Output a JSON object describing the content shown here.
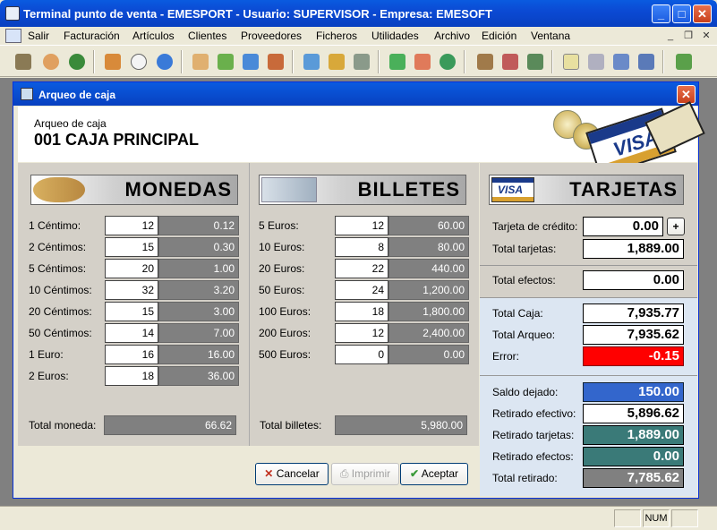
{
  "window": {
    "title": "Terminal punto de venta - EMESPORT - Usuario: SUPERVISOR - Empresa: EMESOFT"
  },
  "menu": [
    "Salir",
    "Facturación",
    "Artículos",
    "Clientes",
    "Proveedores",
    "Ficheros",
    "Utilidades",
    "Archivo",
    "Edición",
    "Ventana"
  ],
  "dialog": {
    "title": "Arqueo de caja",
    "header_label": "Arqueo de caja",
    "header_value": "001 CAJA PRINCIPAL"
  },
  "monedas": {
    "title": "MONEDAS",
    "rows": [
      {
        "label": "1 Céntimo:",
        "qty": "12",
        "amount": "0.12"
      },
      {
        "label": "2 Céntimos:",
        "qty": "15",
        "amount": "0.30"
      },
      {
        "label": "5 Céntimos:",
        "qty": "20",
        "amount": "1.00"
      },
      {
        "label": "10 Céntimos:",
        "qty": "32",
        "amount": "3.20"
      },
      {
        "label": "20 Céntimos:",
        "qty": "15",
        "amount": "3.00"
      },
      {
        "label": "50 Céntimos:",
        "qty": "14",
        "amount": "7.00"
      },
      {
        "label": "1 Euro:",
        "qty": "16",
        "amount": "16.00"
      },
      {
        "label": "2 Euros:",
        "qty": "18",
        "amount": "36.00"
      }
    ],
    "total_label": "Total moneda:",
    "total": "66.62"
  },
  "billetes": {
    "title": "BILLETES",
    "rows": [
      {
        "label": "5 Euros:",
        "qty": "12",
        "amount": "60.00"
      },
      {
        "label": "10 Euros:",
        "qty": "8",
        "amount": "80.00"
      },
      {
        "label": "20 Euros:",
        "qty": "22",
        "amount": "440.00"
      },
      {
        "label": "50 Euros:",
        "qty": "24",
        "amount": "1,200.00"
      },
      {
        "label": "100 Euros:",
        "qty": "18",
        "amount": "1,800.00"
      },
      {
        "label": "200 Euros:",
        "qty": "12",
        "amount": "2,400.00"
      },
      {
        "label": "500 Euros:",
        "qty": "0",
        "amount": "0.00"
      }
    ],
    "total_label": "Total billetes:",
    "total": "5,980.00"
  },
  "tarjetas": {
    "title": "TARJETAS",
    "credito_label": "Tarjeta de crédito:",
    "credito": "0.00",
    "add": "+",
    "total_tarjetas_label": "Total tarjetas:",
    "total_tarjetas": "1,889.00",
    "efectos_label": "Total efectos:",
    "efectos": "0.00",
    "caja_label": "Total Caja:",
    "caja": "7,935.77",
    "arqueo_label": "Total Arqueo:",
    "arqueo": "7,935.62",
    "error_label": "Error:",
    "error": "-0.15",
    "saldo_label": "Saldo dejado:",
    "saldo": "150.00",
    "ret_efectivo_label": "Retirado efectivo:",
    "ret_efectivo": "5,896.62",
    "ret_tarjetas_label": "Retirado tarjetas:",
    "ret_tarjetas": "1,889.00",
    "ret_efectos_label": "Retirado efectos:",
    "ret_efectos": "0.00",
    "total_retirado_label": "Total retirado:",
    "total_retirado": "7,785.62"
  },
  "buttons": {
    "cancel": "Cancelar",
    "print": "Imprimir",
    "accept": "Aceptar"
  },
  "statusbar": {
    "num": "NUM"
  },
  "colors": {
    "error": "#FF0000",
    "saldo": "#3366CC",
    "retirado": "#3A7A78",
    "accent": "#0A5BE0"
  }
}
